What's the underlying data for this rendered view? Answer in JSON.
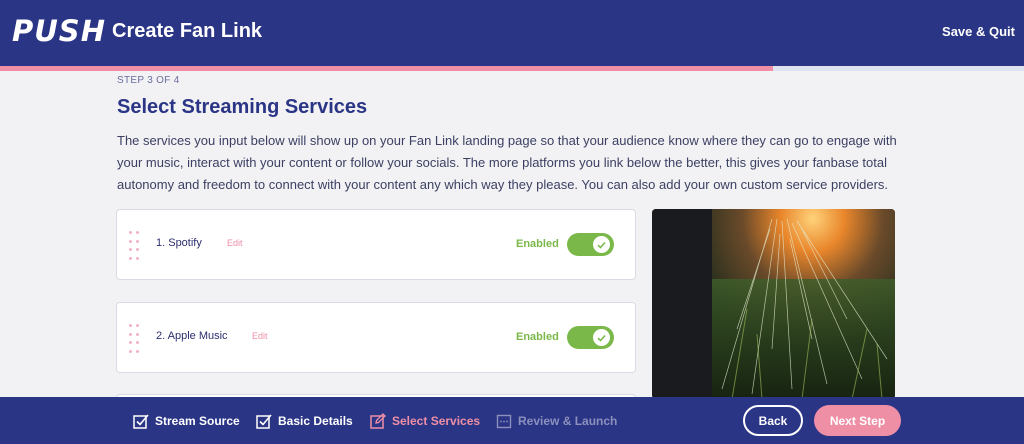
{
  "header": {
    "logo": "PUSH",
    "title": "Create Fan Link",
    "save_quit": "Save & Quit"
  },
  "progress": {
    "fraction": 0.755
  },
  "step_label": "STEP 3 OF 4",
  "heading": "Select Streaming Services",
  "description": "The services you input below will show up on your Fan Link landing page so that your audience know where they can go to engage with your music, interact with your content or follow your socials. The more platforms you link below the better, this gives your fanbase total autonomy and freedom to connect with your content any which way they please. You can also add your own custom service providers.",
  "services": [
    {
      "name": "1. Spotify",
      "edit": "Edit",
      "status": "Enabled",
      "enabled": true
    },
    {
      "name": "2. Apple Music",
      "edit": "Edit",
      "status": "Enabled",
      "enabled": true
    }
  ],
  "bottom_nav": {
    "steps": [
      {
        "label": "Stream Source",
        "state": "done",
        "icon": "check-square-icon"
      },
      {
        "label": "Basic Details",
        "state": "done",
        "icon": "check-square-icon"
      },
      {
        "label": "Select Services",
        "state": "current",
        "icon": "edit-square-icon"
      },
      {
        "label": "Review & Launch",
        "state": "pending",
        "icon": "dotted-square-icon"
      }
    ],
    "back_label": "Back",
    "next_label": "Next Step"
  },
  "colors": {
    "navy": "#2b3585",
    "pink": "#ee8fa6",
    "green": "#7bb84a",
    "background": "#f2f2f4"
  }
}
